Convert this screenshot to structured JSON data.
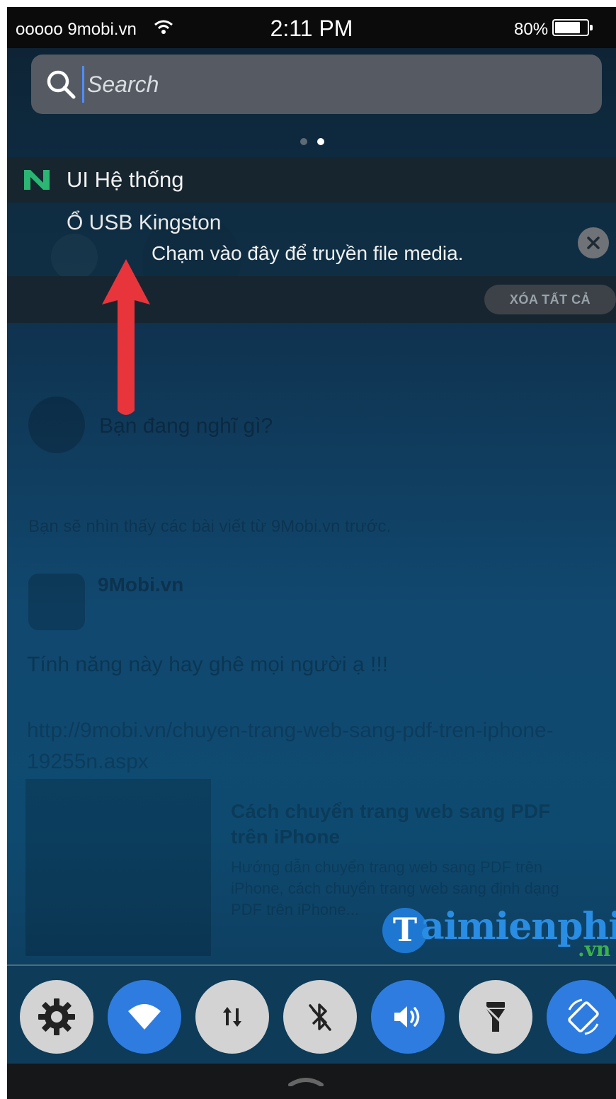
{
  "status_bar": {
    "carrier": "ooooo 9mobi.vn",
    "time": "2:11 PM",
    "battery_percent": "80%",
    "battery_level": 0.8
  },
  "search": {
    "placeholder": "Search"
  },
  "page_dots": {
    "count": 2,
    "active_index": 1
  },
  "notification": {
    "app_name": "UI Hệ thống",
    "title": "Ổ USB Kingston",
    "message": "Chạm vào đây để truyền file media.",
    "clear_all_label": "XÓA TẤT CẢ",
    "app_icon_color": "#2bb673"
  },
  "background_feed": {
    "post_prompt": "Bạn đang nghĩ gì?",
    "see_first_notice": "Bạn sẽ nhìn thấy các bài viết từ 9Mobi.vn trước.",
    "page_name": "9Mobi.vn",
    "post_text": "Tính năng này hay ghê mọi người ạ !!!",
    "post_url": "http://9mobi.vn/chuyen-trang-web-sang-pdf-tren-iphone-19255n.aspx",
    "link_title": "Cách chuyển trang web sang PDF trên iPhone",
    "link_desc": "Hướng dẫn chuyển trang web sang PDF trên iPhone, cách chuyển trang web sang định dạng PDF trên iPhone..."
  },
  "watermark": {
    "initial": "T",
    "text": "aimienphi",
    "suffix": ".vn"
  },
  "toggles": [
    {
      "name": "settings",
      "icon": "gear-icon",
      "state": "off"
    },
    {
      "name": "wifi",
      "icon": "wifi-icon",
      "state": "on"
    },
    {
      "name": "mobile-data",
      "icon": "data-arrows-icon",
      "state": "off"
    },
    {
      "name": "bluetooth",
      "icon": "bluetooth-off-icon",
      "state": "off"
    },
    {
      "name": "sound",
      "icon": "speaker-icon",
      "state": "on"
    },
    {
      "name": "flashlight",
      "icon": "flashlight-icon",
      "state": "off"
    },
    {
      "name": "auto-rotate",
      "icon": "rotate-icon",
      "state": "on"
    }
  ],
  "colors": {
    "accent_blue": "#2f7ce0",
    "toggle_off": "#d3d3d3",
    "annotation_red": "#e8353b",
    "watermark_blue": "#2a8de4",
    "watermark_green": "#3bb14a"
  }
}
